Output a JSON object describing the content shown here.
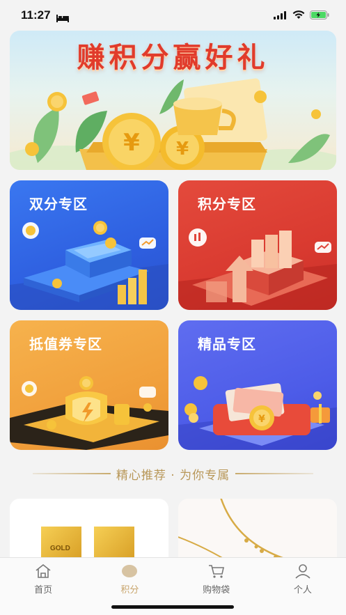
{
  "status_bar": {
    "time": "11:27"
  },
  "banner": {
    "title": "赚积分赢好礼"
  },
  "zones": [
    {
      "label": "双分专区"
    },
    {
      "label": "积分专区"
    },
    {
      "label": "抵值券专区"
    },
    {
      "label": "精品专区"
    }
  ],
  "recommend": {
    "label": "精心推荐 · 为你专属"
  },
  "products": [
    {
      "gold_text": "GOLD"
    }
  ],
  "tabbar": {
    "items": [
      {
        "label": "首页",
        "icon": "home-icon"
      },
      {
        "label": "积分",
        "icon": "points-icon"
      },
      {
        "label": "购物袋",
        "icon": "cart-icon"
      },
      {
        "label": "个人",
        "icon": "profile-icon"
      }
    ],
    "active_index": 1
  },
  "colors": {
    "accent": "#c8a46a",
    "banner_title": "#e13b2b"
  }
}
